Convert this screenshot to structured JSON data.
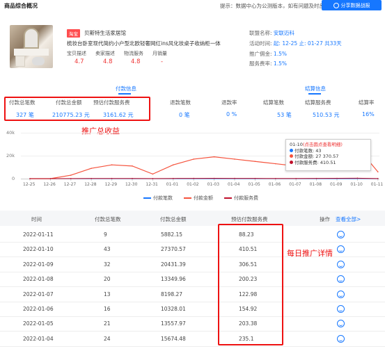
{
  "header": {
    "title": "商品综合概况",
    "tip": "提示：数据中心为公测版本，如有问题及时反馈",
    "share_label": "分享数据战报"
  },
  "product": {
    "shop_tag": "淘宝",
    "shop_name": "贝斯特生活家居馆",
    "title": "梳妆台卧室现代简约小户型北欧轻奢网红ins风化妆桌子收纳柜一体",
    "metrics": [
      {
        "label": "宝贝描述",
        "value": "4.7"
      },
      {
        "label": "卖家描述",
        "value": "4.8"
      },
      {
        "label": "物流服务",
        "value": "4.8"
      },
      {
        "label": "月销量",
        "value": "-"
      }
    ]
  },
  "info": {
    "alliance_label": "联盟名称:",
    "alliance_value": "安联迈科",
    "period_label": "活动时间:",
    "period_value": "起: 12-25 止: 01-27 共33天",
    "commission_label": "推广佣金:",
    "commission_value": "1.5%",
    "fee_label": "服务费率:",
    "fee_value": "1.5%"
  },
  "sections": {
    "payment": "付款信息",
    "settlement": "结算信息"
  },
  "stats": [
    {
      "label": "付款总笔数",
      "value": "327 笔"
    },
    {
      "label": "付款总金额",
      "value": "210775.23 元"
    },
    {
      "label": "预估付款服务费",
      "value": "3161.62 元"
    },
    {
      "label": "退款笔数",
      "value": "0 笔"
    },
    {
      "label": "退款率",
      "value": "0 %"
    },
    {
      "label": "结算笔数",
      "value": "53 笔"
    },
    {
      "label": "结算服务费",
      "value": "510.53 元"
    },
    {
      "label": "结算率",
      "value": "16%"
    }
  ],
  "annotations": {
    "promo_total": "推广总收益",
    "daily_detail": "每日推广详情"
  },
  "chart_data": {
    "type": "line",
    "x": [
      "12-25",
      "12-26",
      "12-27",
      "12-28",
      "12-29",
      "12-30",
      "12-31",
      "01-01",
      "01-02",
      "01-03",
      "01-04",
      "01-05",
      "01-06",
      "01-07",
      "01-08",
      "01-09",
      "01-10",
      "01-11"
    ],
    "yticks": [
      "40k",
      "20k",
      "0"
    ],
    "ylim": [
      0,
      40000
    ],
    "series": [
      {
        "name": "付款笔数",
        "color": "#1677ff",
        "values": [
          0,
          0,
          0,
          0,
          0,
          0,
          0,
          0,
          0,
          0,
          0,
          0,
          0,
          0,
          0,
          0,
          43,
          9
        ]
      },
      {
        "name": "付款金额",
        "color": "#f5533d",
        "values": [
          0,
          0,
          3000,
          9000,
          12000,
          11000,
          4000,
          12000,
          17000,
          19000,
          17000,
          15000,
          13000,
          11000,
          16000,
          20000,
          27370.57,
          5882.15
        ]
      },
      {
        "name": "付款服务费",
        "color": "#c0102b",
        "values": [
          0,
          0,
          45,
          135,
          180,
          165,
          60,
          180,
          255,
          285,
          235.1,
          203.38,
          154.92,
          122.98,
          200.23,
          306.51,
          410.51,
          88.23
        ]
      }
    ],
    "tooltip": {
      "title": "01-10",
      "hint": "(点击圆点查看明细)",
      "rows": [
        "付款笔数: 43",
        "付款金额: 27 370.57",
        "付款服务费: 410.51"
      ]
    }
  },
  "table": {
    "headers": [
      "时间",
      "付款总笔数",
      "付款总金额",
      "预估付款服务费",
      "操作"
    ],
    "view_all": "查看全部>",
    "rows": [
      [
        "2022-01-11",
        "9",
        "5882.15",
        "88.23"
      ],
      [
        "2022-01-10",
        "43",
        "27370.57",
        "410.51"
      ],
      [
        "2022-01-09",
        "32",
        "20431.39",
        "306.51"
      ],
      [
        "2022-01-08",
        "20",
        "13349.96",
        "200.23"
      ],
      [
        "2022-01-07",
        "13",
        "8198.27",
        "122.98"
      ],
      [
        "2022-01-06",
        "16",
        "10328.01",
        "154.92"
      ],
      [
        "2022-01-05",
        "21",
        "13557.97",
        "203.38"
      ],
      [
        "2022-01-04",
        "24",
        "15674.48",
        "235.1"
      ]
    ]
  }
}
